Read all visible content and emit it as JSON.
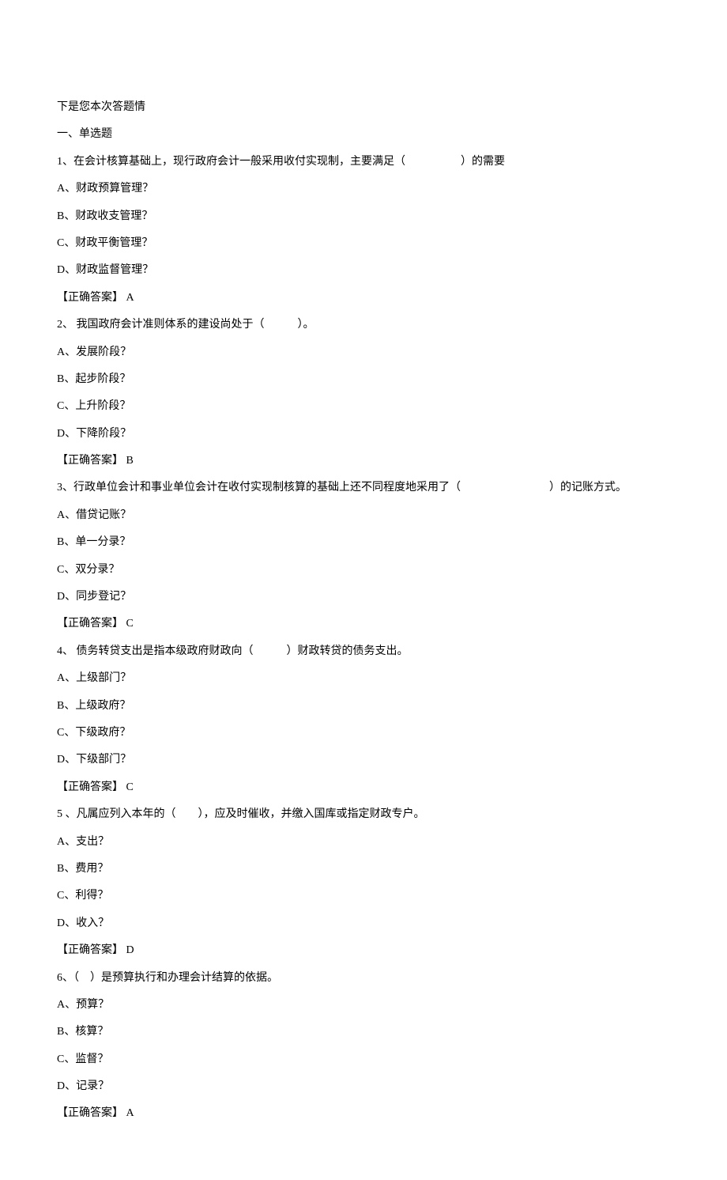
{
  "intro": "下是您本次答题情",
  "section_title": "一、单选题",
  "questions": [
    {
      "stem": "1、在会计核算基础上，现行政府会计一般采用收付实现制，主要满足（　　　　　）的需要",
      "options": [
        "A、财政预算管理？",
        "B、财政收支管理？",
        "C、财政平衡管理？",
        "D、财政监督管理？"
      ],
      "answer": "【正确答案】 A"
    },
    {
      "stem": "2、 我国政府会计准则体系的建设尚处于（　　　）。",
      "options": [
        "A、发展阶段？",
        "B、起步阶段？",
        "C、上升阶段？",
        "D、下降阶段？"
      ],
      "answer": "【正确答案】 B"
    },
    {
      "stem": "3、行政单位会计和事业单位会计在收付实现制核算的基础上还不同程度地采用了（　　　　　　　 ）的记账方式。",
      "options": [
        "A、借贷记账？",
        "B、单一分录？",
        "C、双分录？",
        "D、同步登记？"
      ],
      "answer": "【正确答案】 C"
    },
    {
      "stem": "4、 债务转贷支出是指本级政府财政向（　　　）财政转贷的债务支出。",
      "options": [
        "A、上级部门？",
        "B、上级政府？",
        "C、下级政府？",
        "D、下级部门？"
      ],
      "answer": "【正确答案】 C"
    },
    {
      "stem": "5 、凡属应列入本年的（　　），应及时催收，并缴入国库或指定财政专户。",
      "options": [
        "A、支出？",
        "B、费用？",
        "C、利得？",
        "D、收入？"
      ],
      "answer": "【正确答案】 D"
    },
    {
      "stem": "6、（　）是预算执行和办理会计结算的依据。",
      "options": [
        "A、预算？",
        "B、核算？",
        "C、监督？",
        "D、记录？"
      ],
      "answer": "【正确答案】 A"
    }
  ]
}
